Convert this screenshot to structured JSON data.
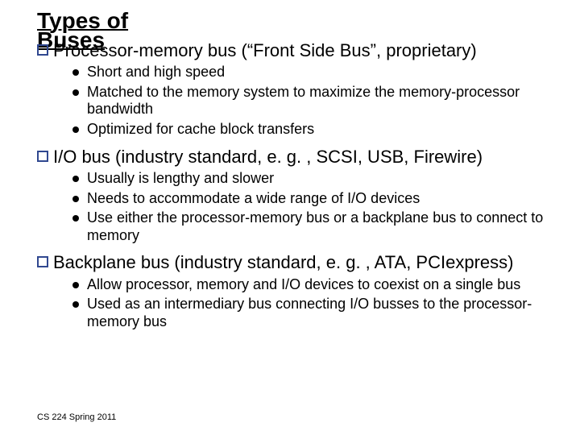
{
  "title_line1": "Types of",
  "title_line2": "Buses",
  "sections": [
    {
      "heading": "Processor-memory bus (“Front Side Bus”, proprietary)",
      "bullets": [
        "Short and high speed",
        "Matched to the memory system to maximize the memory-processor bandwidth",
        "Optimized for cache block transfers"
      ]
    },
    {
      "heading": "I/O bus (industry standard, e. g. , SCSI, USB, Firewire)",
      "bullets": [
        "Usually is lengthy and slower",
        "Needs to accommodate a wide range of I/O devices",
        "Use either the processor-memory bus or a backplane bus to connect to memory"
      ]
    },
    {
      "heading": "Backplane bus (industry standard, e. g. , ATA, PCIexpress)",
      "bullets": [
        "Allow processor, memory and I/O devices to coexist on a single bus",
        "Used as an intermediary bus connecting I/O busses to the processor-memory bus"
      ]
    }
  ],
  "footer": "CS 224 Spring 2011"
}
